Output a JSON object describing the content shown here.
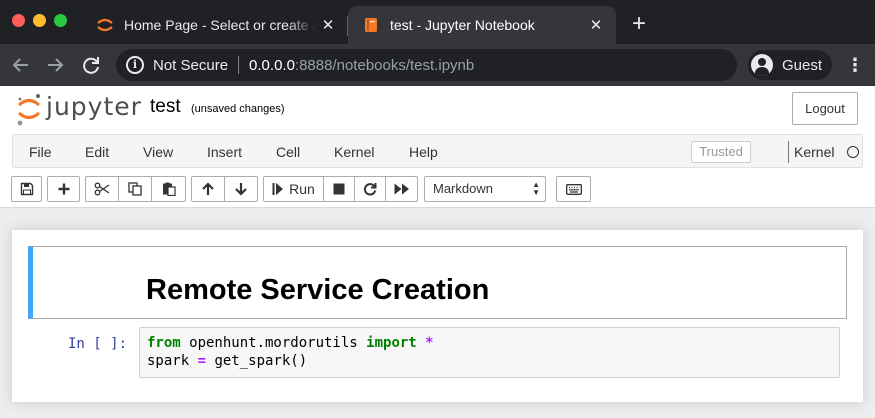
{
  "browser": {
    "tabs": [
      {
        "title": "Home Page - Select or create a notebook",
        "close": "✕",
        "active": false
      },
      {
        "title": "test - Jupyter Notebook",
        "close": "✕",
        "active": true
      }
    ],
    "new_tab": "+",
    "address": {
      "security": "Not Secure",
      "host": "0.0.0.0",
      "rest": ":8888/notebooks/test.ipynb"
    },
    "profile": "Guest"
  },
  "jupyter": {
    "logo_text": "jupyter",
    "notebook_name": "test",
    "save_status": "(unsaved changes)",
    "logout_label": "Logout",
    "menu": [
      "File",
      "Edit",
      "View",
      "Insert",
      "Cell",
      "Kernel",
      "Help"
    ],
    "trusted_label": "Trusted",
    "kernel_label": "Kernel",
    "toolbar": {
      "run_label": "Run",
      "cell_type": "Markdown",
      "icons": [
        "save-icon",
        "plus-icon",
        "cut-icon",
        "copy-icon",
        "paste-icon",
        "arrow-up-icon",
        "arrow-down-icon",
        "step-forward-icon",
        "stop-icon",
        "restart-icon",
        "fast-forward-icon",
        "keyboard-icon"
      ]
    },
    "colors": {
      "accent": "#42a5f5",
      "prompt": "#303f9f",
      "keyword": "#008000",
      "operator": "#aa22ff",
      "logo_orange": "#f37726"
    }
  },
  "cells": {
    "markdown": {
      "heading": "Remote Service Creation"
    },
    "code": {
      "prompt": "In [ ]:",
      "line1": {
        "kw_from": "from",
        "module": " openhunt.mordorutils ",
        "kw_import": "import",
        "star": " *"
      },
      "line2": {
        "var": "spark",
        "eq": " = ",
        "call": " get_spark()"
      }
    }
  }
}
